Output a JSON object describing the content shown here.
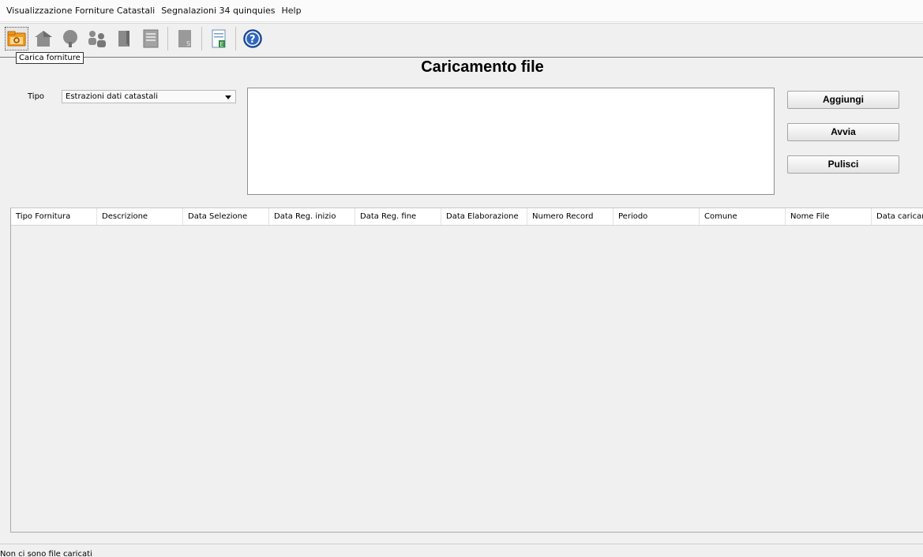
{
  "menu": [
    "Visualizzazione Forniture Catastali",
    "Segnalazioni 34 quinquies",
    "Help"
  ],
  "toolbar": {
    "buttons": [
      {
        "icon": "folder-upload-icon",
        "active": true
      },
      {
        "icon": "house-icon"
      },
      {
        "icon": "tree-icon"
      },
      {
        "icon": "people-icon"
      },
      {
        "icon": "document-icon"
      },
      {
        "icon": "register-icon"
      },
      {
        "icon": "spreadsheet-s-icon"
      },
      {
        "icon": "spreadsheet-e-icon"
      },
      {
        "icon": "help-icon"
      }
    ],
    "tooltip": "Carica forniture"
  },
  "page": {
    "title": "Caricamento file"
  },
  "form": {
    "tipo_label": "Tipo",
    "tipo_value": "Estrazioni dati catastali"
  },
  "actions": {
    "aggiungi": "Aggiungi",
    "avvia": "Avvia",
    "pulisci": "Pulisci"
  },
  "table": {
    "columns": [
      "Tipo Fornitura",
      "Descrizione",
      "Data Selezione",
      "Data Reg. inizio",
      "Data Reg. fine",
      "Data Elaborazione",
      "Numero Record",
      "Periodo",
      "Comune",
      "Nome File",
      "Data caricamen"
    ]
  },
  "status": {
    "text": "Non ci sono file caricati"
  }
}
